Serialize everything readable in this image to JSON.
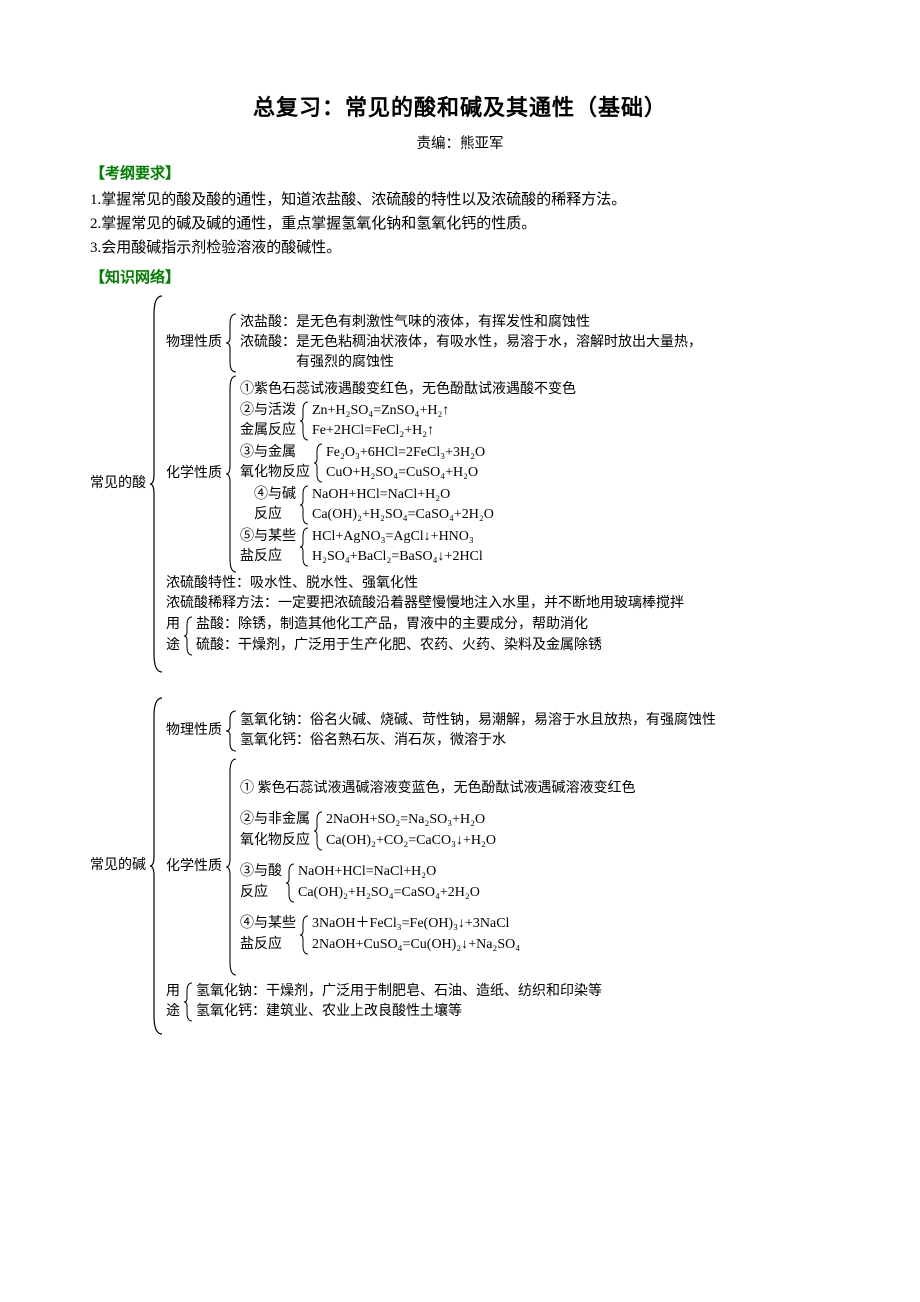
{
  "title": "总复习：常见的酸和碱及其通性（基础）",
  "author": "责编：熊亚军",
  "section_outline": "【考纲要求】",
  "outline": {
    "item1": "1.掌握常见的酸及酸的通性，知道浓盐酸、浓硫酸的特性以及浓硫酸的稀释方法。",
    "item2": "2.掌握常见的碱及碱的通性，重点掌握氢氧化钠和氢氧化钙的性质。",
    "item3": "3.会用酸碱指示剂检验溶液的酸碱性。"
  },
  "section_network": "【知识网络】",
  "acid": {
    "root_label": "常见的酸",
    "phys_label": "物理性质",
    "phys_hcl": "浓盐酸：是无色有刺激性气味的液体，有挥发性和腐蚀性",
    "phys_h2so4_a": "浓硫酸：是无色粘稠油状液体，有吸水性，易溶于水，溶解时放出大量热，",
    "phys_h2so4_b": "有强烈的腐蚀性",
    "chem_label": "化学性质",
    "chem1": "①紫色石蕊试液遇酸变红色，无色酚酞试液遇酸不变色",
    "chem2_label": "②与活泼\n金属反应",
    "chem2_eq1": "Zn+H₂SO₄=ZnSO₄+H₂↑",
    "chem2_eq2": "Fe+2HCl=FeCl₂+H₂↑",
    "chem3_label": "③与金属\n氧化物反应",
    "chem3_eq1": "Fe₂O₃+6HCl=2FeCl₃+3H₂O",
    "chem3_eq2": "CuO+H₂SO₄=CuSO₄+H₂O",
    "chem4_label": "④与碱\n反应",
    "chem4_eq1": "NaOH+HCl=NaCl+H₂O",
    "chem4_eq2": "Ca(OH)₂+H₂SO₄=CaSO₄+2H₂O",
    "chem5_label": "⑤与某些\n盐反应",
    "chem5_eq1": "HCl+AgNO₃=AgCl↓+HNO₃",
    "chem5_eq2": "H₂SO₄+BaCl₂=BaSO₄↓+2HCl",
    "special": "浓硫酸特性：吸水性、脱水性、强氧化性",
    "dilute": "浓硫酸稀释方法：一定要把浓硫酸沿着器壁慢慢地注入水里，并不断地用玻璃棒搅拌",
    "use_label": "用\n途",
    "use1": "盐酸：除锈，制造其他化工产品，胃液中的主要成分，帮助消化",
    "use2": "硫酸：干燥剂，广泛用于生产化肥、农药、火药、染料及金属除锈"
  },
  "base": {
    "root_label": "常见的碱",
    "phys_label": "物理性质",
    "phys_naoh": "氢氧化钠：俗名火碱、烧碱、苛性钠，易潮解，易溶于水且放热，有强腐蚀性",
    "phys_caoh": "氢氧化钙：俗名熟石灰、消石灰，微溶于水",
    "chem_label": "化学性质",
    "chem1": "① 紫色石蕊试液遇碱溶液变蓝色，无色酚酞试液遇碱溶液变红色",
    "chem2_label": "②与非金属\n氧化物反应",
    "chem2_eq1": "2NaOH+SO₂=Na₂SO₃+H₂O",
    "chem2_eq2": "Ca(OH)₂+CO₂=CaCO₃↓+H₂O",
    "chem3_label": "③与酸\n反应",
    "chem3_eq1": "NaOH+HCl=NaCl+H₂O",
    "chem3_eq2": "Ca(OH)₂+H₂SO₄=CaSO₄+2H₂O",
    "chem4_label": "④与某些\n盐反应",
    "chem4_eq1": "3NaOH＋FeCl₃=Fe(OH)₃↓+3NaCl",
    "chem4_eq2": "2NaOH+CuSO₄=Cu(OH)₂↓+Na₂SO₄",
    "use_label": "用\n途",
    "use1": "氢氧化钠：干燥剂，广泛用于制肥皂、石油、造纸、纺织和印染等",
    "use2": "氢氧化钙：建筑业、农业上改良酸性土壤等"
  }
}
